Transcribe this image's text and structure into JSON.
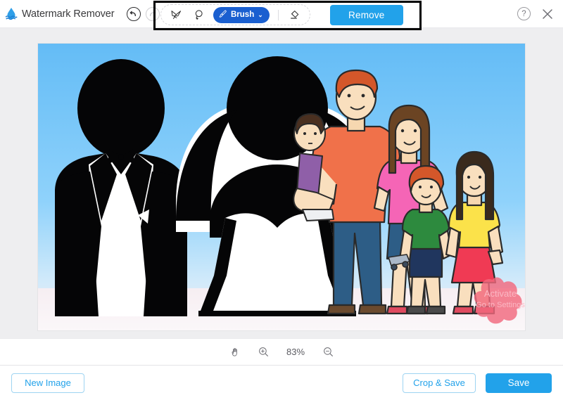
{
  "app": {
    "title": "Watermark Remover",
    "logo_icon": "water-drop-icon"
  },
  "header": {
    "undo_icon": "undo-arrow-icon",
    "redo_icon": "redo-arrow-icon",
    "help_label": "?",
    "help_icon": "help-circle-icon",
    "close_icon": "close-x-icon"
  },
  "toolbar": {
    "tools": [
      {
        "name": "magic-wand-icon",
        "label": "Magic Wand",
        "active": false
      },
      {
        "name": "lasso-icon",
        "label": "Lasso",
        "active": false
      }
    ],
    "brush": {
      "label": "Brush",
      "icon": "brush-icon",
      "chevron": "⌄",
      "active": true,
      "color": "#1a5fd0"
    },
    "eraser": {
      "name": "eraser-icon",
      "label": "Eraser"
    },
    "remove_label": "Remove",
    "remove_color": "#22a2ea",
    "highlight_box_color": "#000000"
  },
  "canvas": {
    "image_alt": "Wedding couple silhouette with cartoon family",
    "watermark_text_line1": "Activate",
    "watermark_text_line2": "Go to Settings",
    "mask_color": "#f2697e"
  },
  "zoombar": {
    "pan_icon": "hand-pan-icon",
    "zoom_in_icon": "zoom-in-icon",
    "zoom_out_icon": "zoom-out-icon",
    "zoom_level": "83%"
  },
  "footer": {
    "new_image_label": "New Image",
    "crop_save_label": "Crop & Save",
    "save_label": "Save",
    "accent_color": "#22a2ea"
  }
}
